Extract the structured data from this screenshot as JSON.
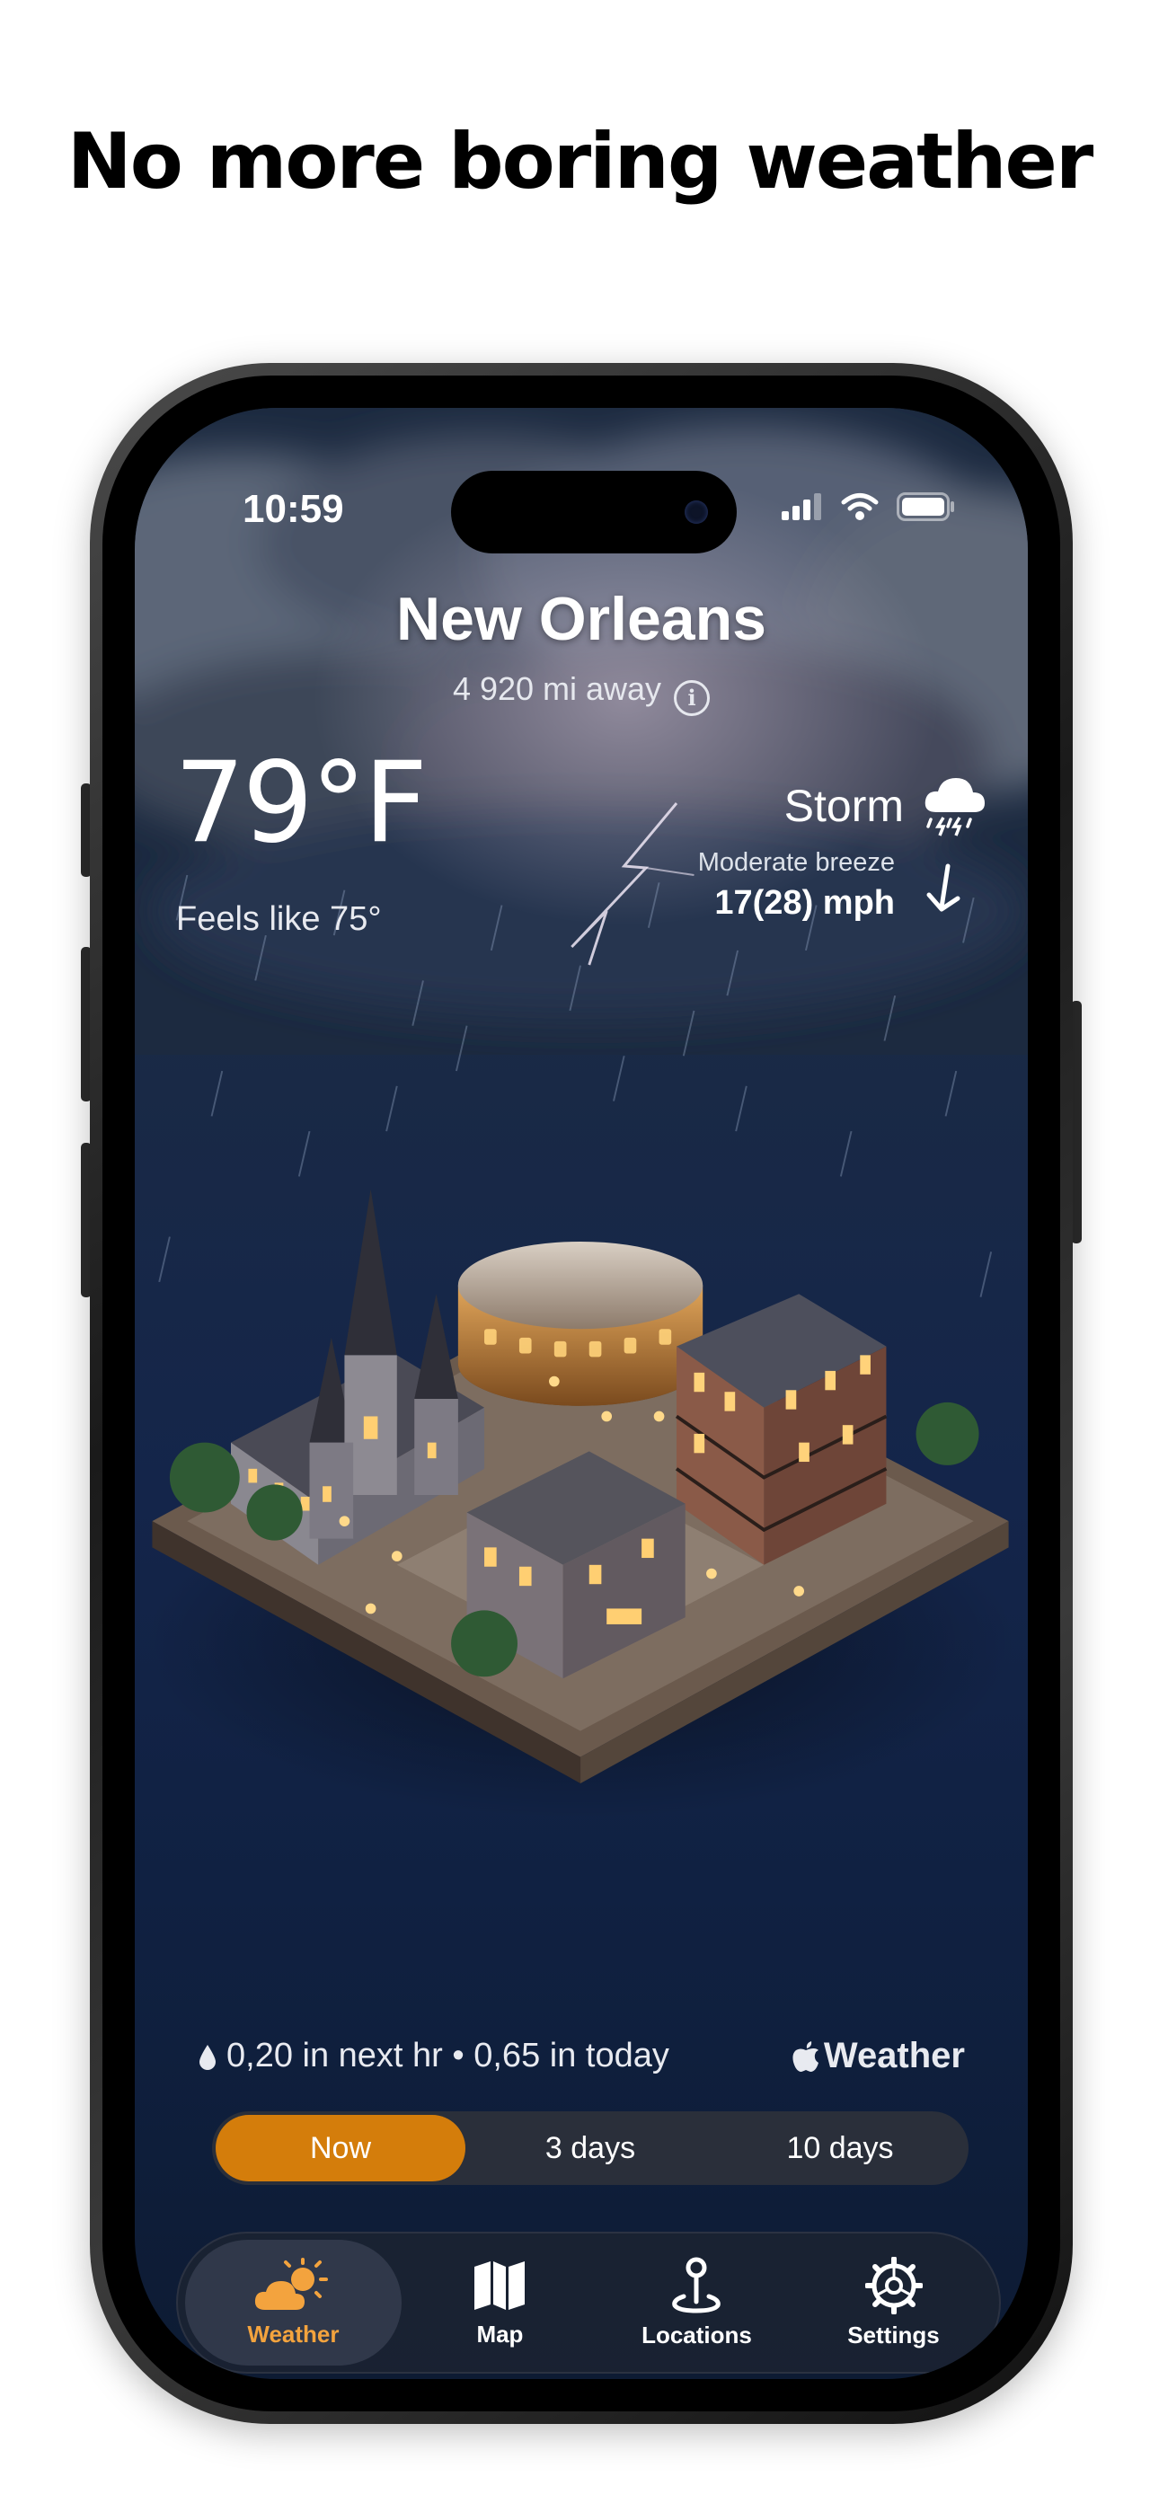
{
  "headline": "No more boring weather",
  "status_bar": {
    "time": "10:59"
  },
  "location": {
    "city": "New Orleans",
    "distance": "4 920 mi away"
  },
  "current": {
    "temperature": "79°F",
    "feels_like": "Feels like 75°",
    "condition": "Storm",
    "wind_description": "Moderate breeze",
    "wind_speed": "17(28) mph"
  },
  "precipitation": {
    "text": "0,20 in next hr • 0,65 in today",
    "attribution": "Weather"
  },
  "range_selector": {
    "options": [
      "Now",
      "3 days",
      "10 days"
    ],
    "selected": "Now"
  },
  "tabbar": {
    "items": [
      {
        "label": "Weather",
        "icon": "weather-sun-cloud-icon"
      },
      {
        "label": "Map",
        "icon": "map-icon"
      },
      {
        "label": "Locations",
        "icon": "location-pin-icon"
      },
      {
        "label": "Settings",
        "icon": "gear-icon"
      }
    ],
    "active": "Weather"
  },
  "colors": {
    "accent": "#d47d0b",
    "active_tab_text": "#f3a33e",
    "sky_top": "#1e2d44",
    "sky_bottom": "#0d1b33"
  }
}
